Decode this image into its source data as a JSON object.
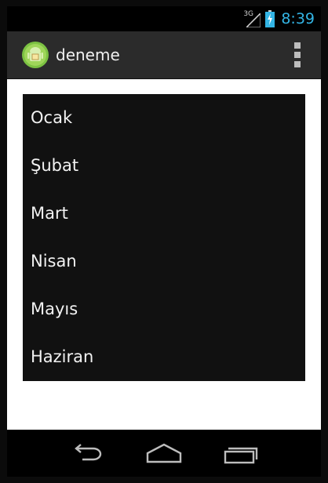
{
  "status_bar": {
    "network": "3G",
    "time": "8:39"
  },
  "action_bar": {
    "title": "deneme",
    "app_icon": "android-app-icon",
    "overflow_icon": "overflow-menu-icon"
  },
  "list": {
    "items": [
      "Ocak",
      "Şubat",
      "Mart",
      "Nisan",
      "Mayıs",
      "Haziran"
    ]
  },
  "nav_bar": {
    "back_icon": "back-icon",
    "home_icon": "home-icon",
    "recents_icon": "recents-icon"
  },
  "colors": {
    "clock": "#33b5e5",
    "action_bar_bg": "#2b2b2b",
    "list_bg": "#111111",
    "content_bg": "#ffffff",
    "system_bar_bg": "#000000"
  }
}
